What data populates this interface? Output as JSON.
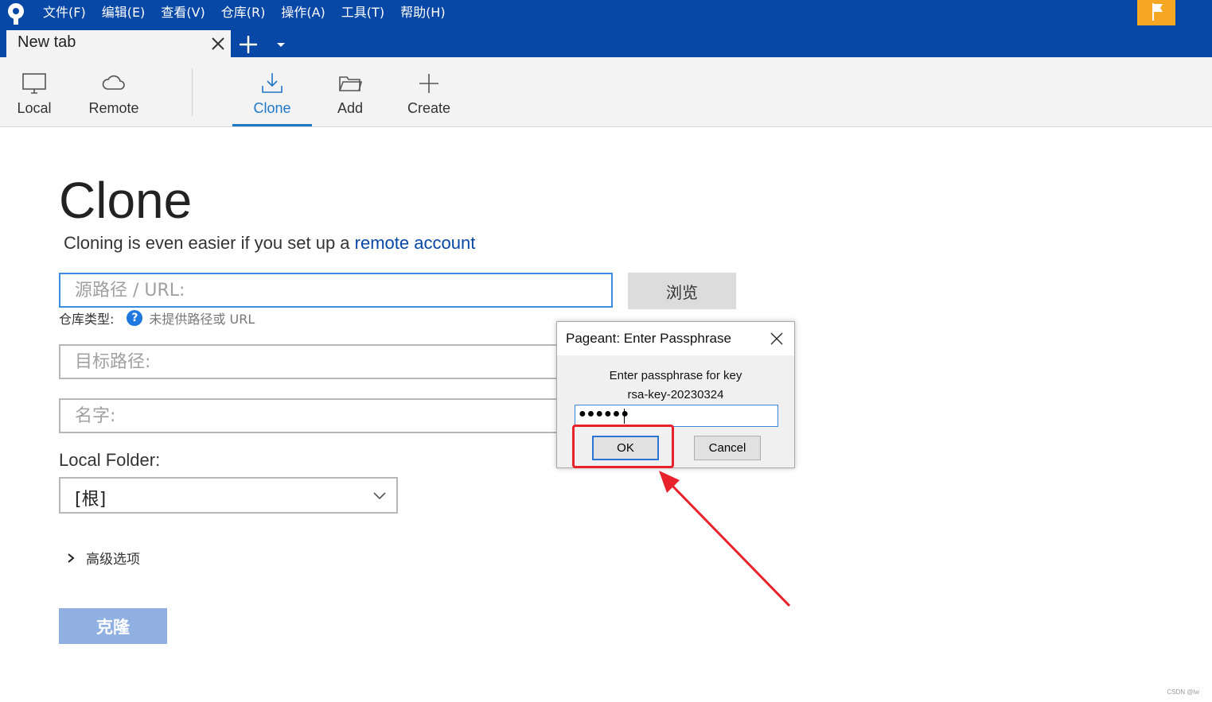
{
  "menu": {
    "items": [
      "文件(F)",
      "编辑(E)",
      "查看(V)",
      "仓库(R)",
      "操作(A)",
      "工具(T)",
      "帮助(H)"
    ]
  },
  "tab": {
    "title": "New tab"
  },
  "toolbar": {
    "local": "Local",
    "remote": "Remote",
    "clone": "Clone",
    "add": "Add",
    "create": "Create"
  },
  "clone": {
    "title": "Clone",
    "subtitle_prefix": "Cloning is even easier if you set up a",
    "subtitle_link": "remote account",
    "source_placeholder": "源路径 / URL:",
    "browse_label": "浏览",
    "repo_type_label": "仓库类型:",
    "repo_type_note": "未提供路径或 URL",
    "dest_placeholder": "目标路径:",
    "name_placeholder": "名字:",
    "local_folder_label": "Local Folder:",
    "local_folder_value": "[根]",
    "advanced_label": "高级选项",
    "clone_button": "克隆"
  },
  "dialog": {
    "title": "Pageant: Enter Passphrase",
    "message_line1": "Enter passphrase for key",
    "message_line2": "rsa-key-20230324",
    "passphrase_mask": "●●●●●●",
    "ok_label": "OK",
    "cancel_label": "Cancel"
  },
  "colors": {
    "titlebar": "#0747a6",
    "accent": "#1e78c8",
    "flag": "#f5a623",
    "annotation": "#e8212b"
  },
  "watermark": "CSDN @lw"
}
